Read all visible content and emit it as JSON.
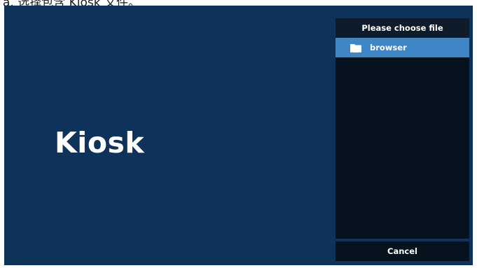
{
  "top_caption": "a. 选择包含 Kiosk 文件。",
  "main": {
    "title": "Kiosk"
  },
  "dialog": {
    "title": "Please choose file",
    "files": [
      {
        "label": "browser",
        "icon": "folder-icon",
        "selected": true
      }
    ],
    "cancel_label": "Cancel"
  },
  "colors": {
    "background": "#0e3259",
    "dialog_background": "#06121e",
    "selected_row": "#3f86c7",
    "text": "#ffffff"
  }
}
